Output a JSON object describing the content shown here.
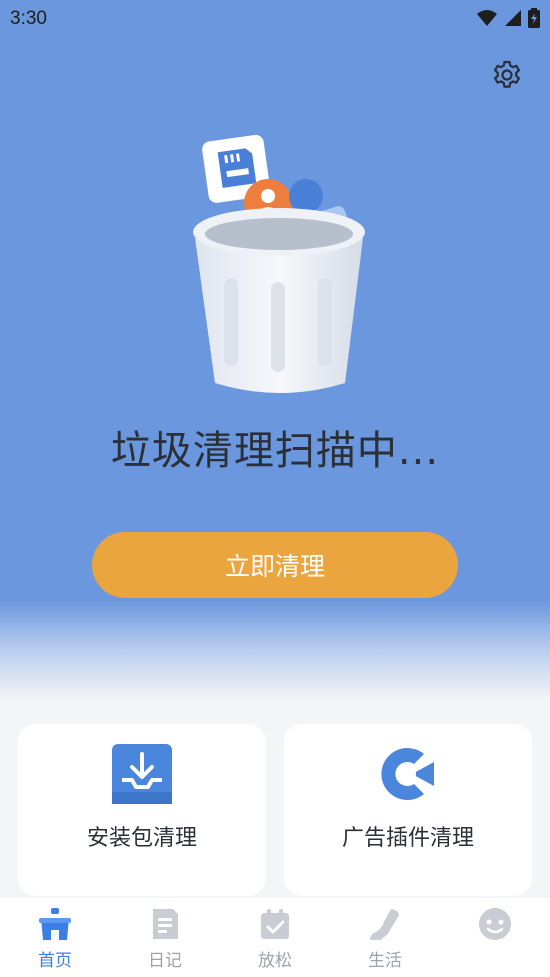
{
  "status_bar": {
    "time": "3:30"
  },
  "hero": {
    "scan_title": "垃圾清理扫描中...",
    "clean_button_label": "立即清理"
  },
  "features": [
    {
      "label": "安装包清理",
      "icon": "download-tray-icon"
    },
    {
      "label": "广告插件清理",
      "icon": "ad-plugin-icon"
    }
  ],
  "nav": {
    "items": [
      {
        "label": "首页",
        "icon": "home-icon",
        "active": true
      },
      {
        "label": "日记",
        "icon": "diary-icon",
        "active": false
      },
      {
        "label": "放松",
        "icon": "calendar-check-icon",
        "active": false
      },
      {
        "label": "生活",
        "icon": "shoe-icon",
        "active": false
      },
      {
        "label": "",
        "icon": "face-icon",
        "active": false
      }
    ]
  },
  "colors": {
    "hero_blue": "#6a97dd",
    "button_orange": "#eba53e",
    "active_blue": "#3a7ee6",
    "inactive_gray": "#9ea3ab"
  }
}
